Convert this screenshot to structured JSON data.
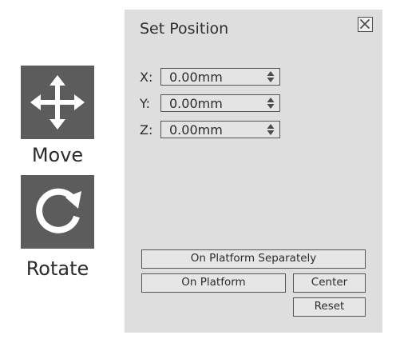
{
  "tools": {
    "move": {
      "label": "Move",
      "icon": "move-arrows-icon"
    },
    "rotate": {
      "label": "Rotate",
      "icon": "rotate-arrow-icon"
    }
  },
  "panel": {
    "title": "Set Position",
    "close_icon": "close-icon",
    "fields": [
      {
        "label": "X:",
        "value": "0.00mm"
      },
      {
        "label": "Y:",
        "value": "0.00mm"
      },
      {
        "label": "Z:",
        "value": "0.00mm"
      }
    ],
    "buttons": {
      "on_platform_separately": "On Platform Separately",
      "on_platform": "On Platform",
      "center": "Center",
      "reset": "Reset"
    }
  },
  "colors": {
    "tool_bg": "#5c5c5c",
    "panel_bg": "#dedede",
    "button_bg": "#e6e6e6"
  }
}
